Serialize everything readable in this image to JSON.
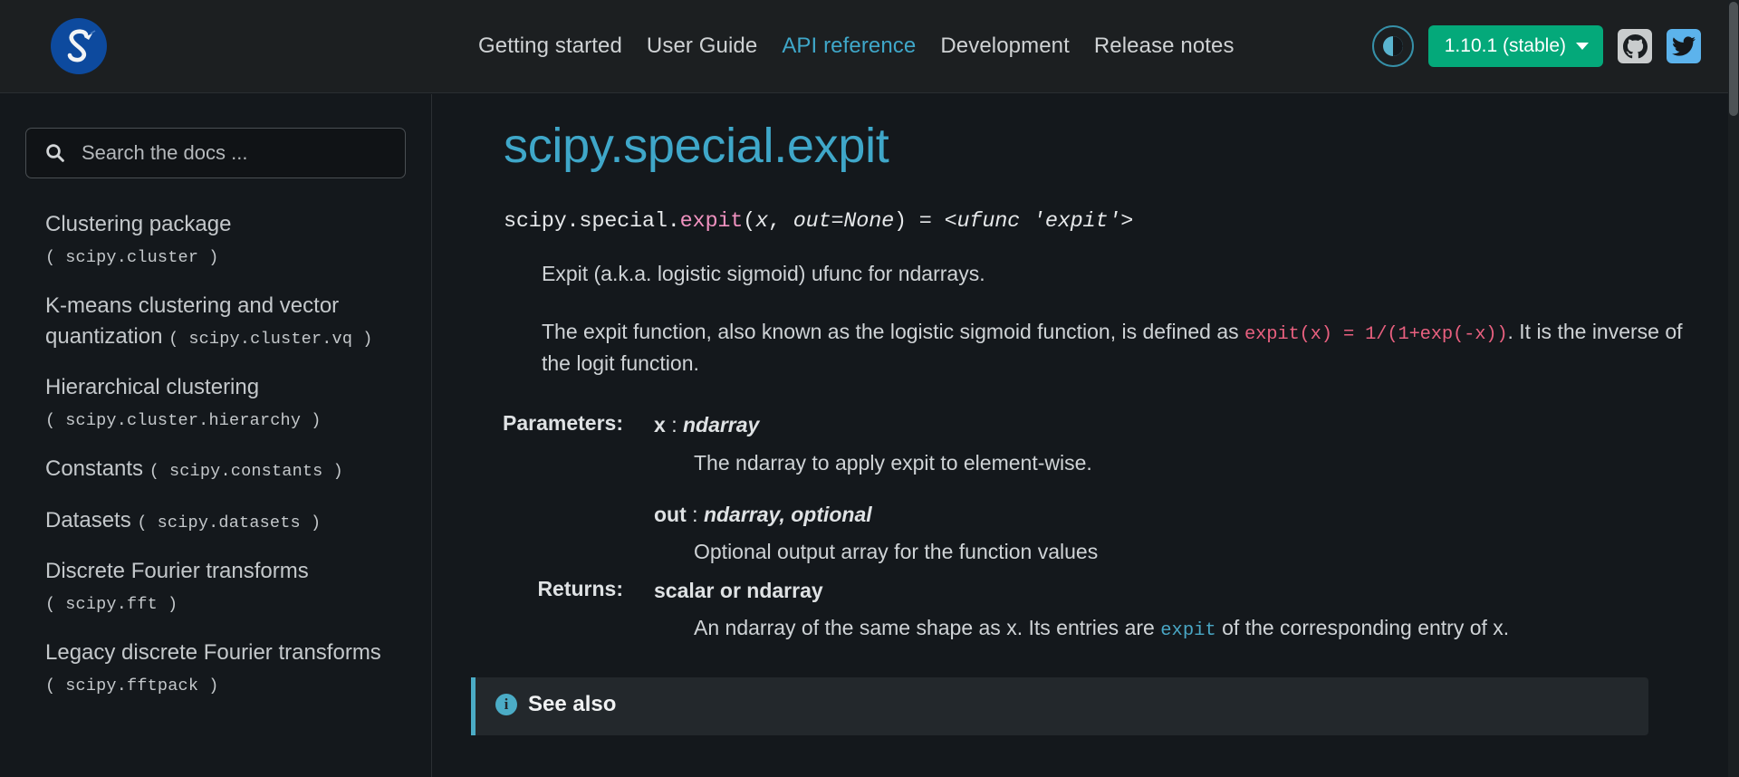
{
  "navbar": {
    "logo_name": "scipy-logo",
    "links": [
      {
        "label": "Getting started",
        "active": false
      },
      {
        "label": "User Guide",
        "active": false
      },
      {
        "label": "API reference",
        "active": true
      },
      {
        "label": "Development",
        "active": false
      },
      {
        "label": "Release notes",
        "active": false
      }
    ],
    "theme_toggle_name": "theme-toggle",
    "version_label": "1.10.1 (stable)",
    "github_label": "GitHub",
    "twitter_label": "Twitter",
    "accent_color": "#3fa7c9",
    "version_bg_color": "#04a97a"
  },
  "sidebar": {
    "search": {
      "placeholder": "Search the docs ...",
      "value": ""
    },
    "items": [
      {
        "title": "Clustering package",
        "module": "scipy.cluster"
      },
      {
        "title": "K-means clustering and vector quantization",
        "module": "scipy.cluster.vq"
      },
      {
        "title": "Hierarchical clustering",
        "module": "scipy.cluster.hierarchy"
      },
      {
        "title": "Constants",
        "module": "scipy.constants"
      },
      {
        "title": "Datasets",
        "module": "scipy.datasets"
      },
      {
        "title": "Discrete Fourier transforms",
        "module": "scipy.fft"
      },
      {
        "title": "Legacy discrete Fourier transforms",
        "module": "scipy.fftpack"
      }
    ]
  },
  "main": {
    "page_title": "scipy.special.expit",
    "signature": {
      "prefix": "scipy.special.",
      "name": "expit",
      "open_paren": "(",
      "arg1": "x",
      "comma": ", ",
      "arg2": "out=None",
      "close_paren": ")",
      "equals": " = ",
      "ufunc": "<ufunc 'expit'>"
    },
    "summary": "Expit (a.k.a. logistic sigmoid) ufunc for ndarrays.",
    "description": {
      "part1": "The expit function, also known as the logistic sigmoid function, is defined as ",
      "code": "expit(x) = 1/(1+exp(-x))",
      "part2": ". It is the inverse of the logit function."
    },
    "parameters_label": "Parameters:",
    "parameters": [
      {
        "name": "x",
        "sep": ":",
        "type": "ndarray",
        "description": "The ndarray to apply expit to element-wise."
      },
      {
        "name": "out",
        "sep": ":",
        "type": "ndarray, optional",
        "description": "Optional output array for the function values"
      }
    ],
    "returns_label": "Returns:",
    "returns": {
      "type": "scalar or ndarray",
      "desc_part1": "An ndarray of the same shape as x. Its entries are ",
      "desc_code": "expit",
      "desc_part2": " of the corresponding entry of x."
    },
    "admonition": {
      "icon": "info-icon",
      "title": "See also"
    }
  }
}
